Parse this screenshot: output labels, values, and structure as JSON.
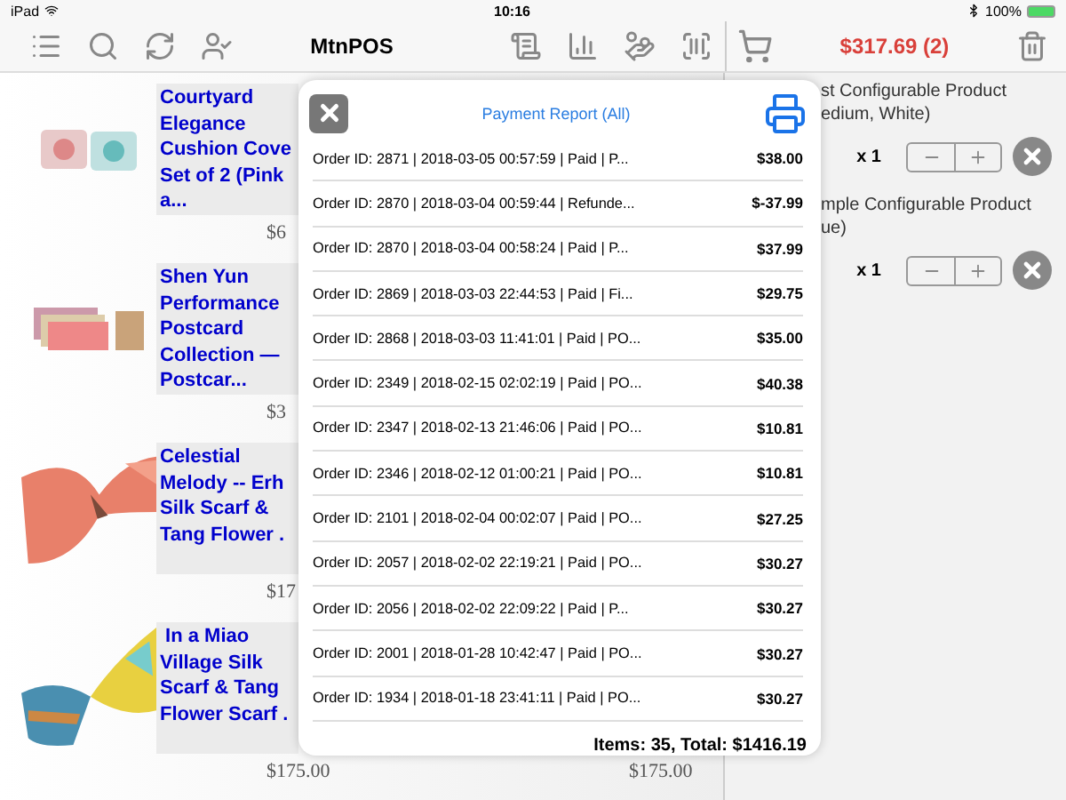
{
  "status_bar": {
    "device": "iPad",
    "time": "10:16",
    "battery": "100%"
  },
  "toolbar": {
    "title": "MtnPOS",
    "cart_total": "$317.69 (2)"
  },
  "product_rows": [
    {
      "title": "Courtyard\nElegance\nCushion Cove\nSet of 2 (Pink\na...",
      "price": "$6"
    },
    {
      "title": "Shen Yun\nPerformance\nPostcard\nCollection —\nPostcar...",
      "price": "$3"
    },
    {
      "title": "Celestial\nMelody -- Erh\nSilk Scarf &\nTang Flower .",
      "price": "$17"
    },
    {
      "title": " In a Miao\nVillage Silk\nScarf & Tang\nFlower Scarf .",
      "price": "$175.00",
      "second_price": "$175.00"
    }
  ],
  "cart": {
    "items": [
      {
        "name": "st Configurable Product\nedium, White)",
        "quantity": "x 1"
      },
      {
        "name": "mple Configurable Product\nue)",
        "quantity": "x 1"
      }
    ]
  },
  "report": {
    "title": "Payment Report (All)",
    "summary": "Items: 35, Total: $1416.19",
    "rows": [
      {
        "text": "Order ID: 2871 | 2018-03-05 00:57:59 | Paid | P...",
        "amount": "$38.00"
      },
      {
        "text": "Order ID: 2870 | 2018-03-04 00:59:44 | Refunde...",
        "amount": "$-37.99"
      },
      {
        "text": "Order ID: 2870 | 2018-03-04 00:58:24 | Paid | P...",
        "amount": "$37.99"
      },
      {
        "text": "Order ID: 2869 | 2018-03-03 22:44:53 | Paid | Fi...",
        "amount": "$29.75"
      },
      {
        "text": "Order ID: 2868 | 2018-03-03 11:41:01 | Paid | PO...",
        "amount": "$35.00"
      },
      {
        "text": "Order ID: 2349 | 2018-02-15 02:02:19 | Paid | PO...",
        "amount": "$40.38"
      },
      {
        "text": "Order ID: 2347 | 2018-02-13 21:46:06 | Paid | PO...",
        "amount": "$10.81"
      },
      {
        "text": "Order ID: 2346 | 2018-02-12 01:00:21 | Paid | PO...",
        "amount": "$10.81"
      },
      {
        "text": "Order ID: 2101 | 2018-02-04 00:02:07 | Paid | PO...",
        "amount": "$27.25"
      },
      {
        "text": "Order ID: 2057 | 2018-02-02 22:19:21 | Paid | PO...",
        "amount": "$30.27"
      },
      {
        "text": "Order ID: 2056 | 2018-02-02 22:09:22 | Paid | P...",
        "amount": "$30.27"
      },
      {
        "text": "Order ID: 2001 | 2018-01-28 10:42:47 | Paid | PO...",
        "amount": "$30.27"
      },
      {
        "text": "Order ID: 1934 | 2018-01-18 23:41:11 | Paid | PO...",
        "amount": "$30.27"
      }
    ]
  }
}
